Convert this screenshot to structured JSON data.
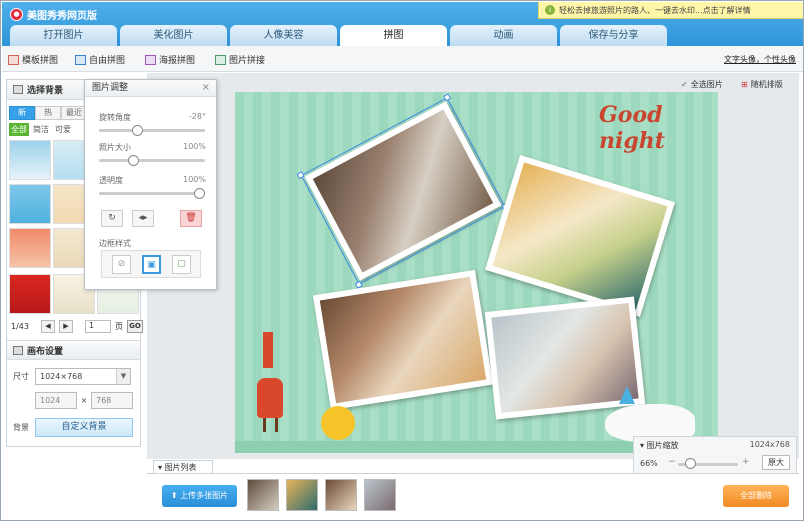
{
  "header": {
    "app_title": "美图秀秀网页版",
    "promo_text": "轻松去掉旅游照片的路人、一键去水印...点击了解详情",
    "tabs": [
      {
        "label": "打开图片"
      },
      {
        "label": "美化图片"
      },
      {
        "label": "人像美容"
      },
      {
        "label": "拼图"
      },
      {
        "label": "动画"
      },
      {
        "label": "保存与分享"
      }
    ],
    "active_tab": "拼图"
  },
  "subtoolbar": {
    "items": [
      {
        "label": "模板拼图",
        "icon": "template-icon"
      },
      {
        "label": "自由拼图",
        "icon": "free-collage-icon"
      },
      {
        "label": "海报拼图",
        "icon": "poster-icon"
      },
      {
        "label": "图片拼接",
        "icon": "stitch-icon"
      }
    ],
    "right_link": "文字头像，个性头像"
  },
  "left_panel": {
    "background": {
      "title": "选择背景",
      "tabs": [
        "新",
        "热",
        "最近"
      ],
      "categories": [
        "全部",
        "简洁",
        "可爱"
      ],
      "pager": {
        "current": "1/43",
        "page_input": "1",
        "page_unit": "页",
        "go_label": "GO"
      }
    },
    "canvas_settings": {
      "title": "画布设置",
      "size_label": "尺寸",
      "size_value": "1024×768",
      "width": "1024",
      "times": "×",
      "height": "768",
      "bg_label": "背景",
      "custom_bg_button": "自定义背景"
    }
  },
  "adjust_panel": {
    "title": "图片调整",
    "close_glyph": "×",
    "sliders": [
      {
        "label": "旋转角度",
        "value": "-28°",
        "position": 0.35
      },
      {
        "label": "照片大小",
        "value": "100%",
        "position": 0.3
      },
      {
        "label": "透明度",
        "value": "100%",
        "position": 1.0
      }
    ],
    "actions": [
      {
        "icon": "rotate-icon",
        "glyph": "↻"
      },
      {
        "icon": "flip-icon",
        "glyph": "◂▸"
      },
      {
        "icon": "delete-icon",
        "glyph": "🗑"
      }
    ],
    "border_label": "边框样式",
    "border_styles": [
      {
        "icon": "no-border-icon",
        "glyph": "⊘"
      },
      {
        "icon": "border-style-1-icon",
        "glyph": "▣"
      },
      {
        "icon": "border-style-2-icon",
        "glyph": "▢"
      }
    ]
  },
  "canvas_top": {
    "select_all": "全选图片",
    "random_arrange": "随机排版"
  },
  "canvas": {
    "decoration_text": "Good night"
  },
  "zoom": {
    "title": "图片缩放",
    "canvas_size": "1024x768",
    "percent": "66%",
    "original_button": "原大",
    "level": 0.66
  },
  "bottom": {
    "photo_list_label": "图片列表",
    "upload_button": "上传多张图片",
    "clear_button": "全部删除"
  },
  "colors": {
    "accent": "#2f94d8",
    "canvas_bg": "#9cd8bd",
    "clear_button": "#f28a22"
  }
}
